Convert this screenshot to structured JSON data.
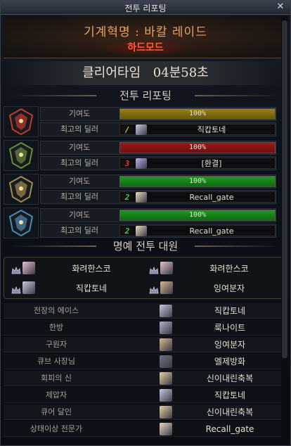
{
  "window": {
    "title": "전투 리포팅",
    "close_icon": "close-icon"
  },
  "banner": {
    "raid_name": "기계혁명 : 바칼 레이드",
    "mode": "하드모드"
  },
  "clear_time": {
    "label": "클리어타임",
    "value": "04분58초"
  },
  "report_header": "전투 리포팅",
  "parties": [
    {
      "emblem_icon": "red-demon-crest-icon",
      "emblem_color": "#c23a2a",
      "contribution_label": "기여도",
      "contribution_text": "100%",
      "contribution_value": 1.0,
      "bar_color": "#9a8212",
      "top_dealer_label": "최고의 딜러",
      "rank_badge": "/",
      "rank_color": "#e8d040",
      "top_dealer_name": "직캅토네",
      "avatar_color": "#c8c8e0"
    },
    {
      "emblem_icon": "green-beast-crest-icon",
      "emblem_color": "#6a8a3a",
      "contribution_label": "기여도",
      "contribution_text": "100%",
      "contribution_value": 1.0,
      "bar_color": "#a01818",
      "top_dealer_label": "최고의 딜러",
      "rank_badge": "3",
      "rank_color": "#e03a3a",
      "top_dealer_name": "[환결]",
      "avatar_color": "#c0b0e8"
    },
    {
      "emblem_icon": "gold-horn-crest-icon",
      "emblem_color": "#a08a50",
      "contribution_label": "기여도",
      "contribution_text": "100%",
      "contribution_value": 1.0,
      "bar_color": "#1e9a1e",
      "top_dealer_label": "최고의 딜러",
      "rank_badge": "2",
      "rank_color": "#3ad03a",
      "top_dealer_name": "Recall_gate",
      "avatar_color": "#e8d8c0"
    },
    {
      "emblem_icon": "blue-ice-crest-icon",
      "emblem_color": "#4a8ab0",
      "contribution_label": "기여도",
      "contribution_text": "100%",
      "contribution_value": 1.0,
      "bar_color": "#1e9a1e",
      "top_dealer_label": "최고의 딜러",
      "rank_badge": "2",
      "rank_color": "#3ad03a",
      "top_dealer_name": "Recall_gate",
      "avatar_color": "#e8d8c0"
    }
  ],
  "honor_header": "명예 전투 대원",
  "honor_members": [
    {
      "name": "화려한스코",
      "avatar_color": "#e8c0d0"
    },
    {
      "name": "화려한스코",
      "avatar_color": "#e8c0d0"
    },
    {
      "name": "직캅토네",
      "avatar_color": "#c8c8e0"
    },
    {
      "name": "잉여분자",
      "avatar_color": "#d8b890"
    }
  ],
  "titles": [
    {
      "label": "전장의 에이스",
      "name": "직캅토네",
      "avatar_color": "#c8c8e0"
    },
    {
      "label": "한방",
      "name": "룩나이트",
      "avatar_color": "#b0b0c8"
    },
    {
      "label": "구원자",
      "name": "잉여분자",
      "avatar_color": "#d8b890"
    },
    {
      "label": "큐브 사장님",
      "name": "엘제방화",
      "avatar_color": "#707080"
    },
    {
      "label": "회피의 신",
      "name": "신이내린축복",
      "avatar_color": "#e8d0a0"
    },
    {
      "label": "제압자",
      "name": "직캅토네",
      "avatar_color": "#c8c8e0"
    },
    {
      "label": "큐어 달인",
      "name": "신이내린축복",
      "avatar_color": "#e8d0a0"
    },
    {
      "label": "상태이상 전문가",
      "name": "Recall_gate",
      "avatar_color": "#e8d8c0"
    }
  ]
}
